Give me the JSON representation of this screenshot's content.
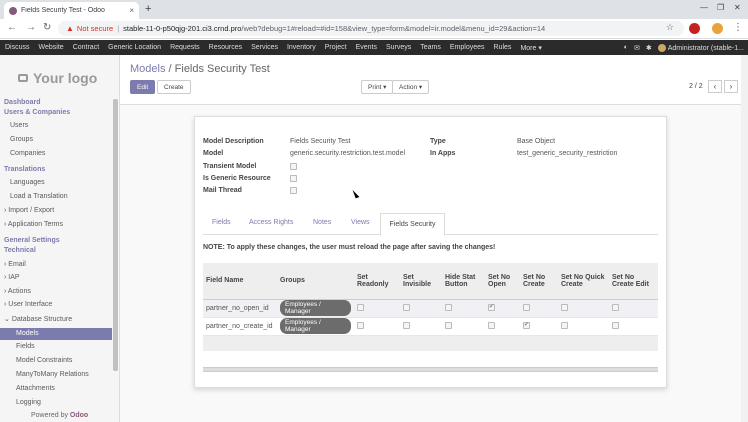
{
  "browser": {
    "tab_title": "Fields Security Test - Odoo",
    "tab_close": "×",
    "new_tab": "+",
    "win_min": "—",
    "win_max": "❐",
    "win_close": "✕",
    "not_secure": "Not secure",
    "url_host": "stable-11-0-p50qjg-201.ci3.crnd.pro",
    "url_path": "/web?debug=1#reload=#id=158&view_type=form&model=ir.model&menu_id=29&action=14"
  },
  "navbar": {
    "menu": [
      "Discuss",
      "Website",
      "Contract",
      "Generic Location",
      "Requests",
      "Resources",
      "Services",
      "Inventory",
      "Project",
      "Events",
      "Surveys",
      "Teams",
      "Employees",
      "Rules",
      "More ▾"
    ],
    "user": "Administrator (stable-1..."
  },
  "sidebar": {
    "logo": "Your logo",
    "dashboard": "Dashboard",
    "users_companies": "Users & Companies",
    "users": "Users",
    "groups": "Groups",
    "companies": "Companies",
    "translations": "Translations",
    "languages": "Languages",
    "load_translation": "Load a Translation",
    "import_export": "Import / Export",
    "application_terms": "Application Terms",
    "general_settings": "General Settings",
    "technical": "Technical",
    "email": "Email",
    "iap": "IAP",
    "actions": "Actions",
    "user_interface": "User Interface",
    "database_structure": "Database Structure",
    "models": "Models",
    "fields": "Fields",
    "model_constraints": "Model Constraints",
    "many2many": "ManyToMany Relations",
    "attachments": "Attachments",
    "logging": "Logging",
    "powered_by": "Powered by",
    "odoo": "Odoo"
  },
  "control": {
    "breadcrumb_parent": "Models",
    "breadcrumb_sep": "/",
    "breadcrumb_current": "Fields Security Test",
    "edit": "Edit",
    "create": "Create",
    "print": "Print ▾",
    "action": "Action ▾",
    "pager": "2 / 2",
    "prev": "‹",
    "next": "›"
  },
  "form": {
    "model_description_label": "Model Description",
    "model_description": "Fields Security Test",
    "model_label": "Model",
    "model": "generic.security.restriction.test.model",
    "transient_label": "Transient Model",
    "generic_resource_label": "Is Generic Resource",
    "mail_thread_label": "Mail Thread",
    "type_label": "Type",
    "type": "Base Object",
    "in_apps_label": "In Apps",
    "in_apps": "test_generic_security_restriction",
    "tabs": [
      "Fields",
      "Access Rights",
      "Notes",
      "Views"
    ],
    "active_tab": "Fields Security",
    "note": "NOTE: To apply these changes, the user must reload the page after saving the changes!"
  },
  "table": {
    "headers": [
      "Field Name",
      "Groups",
      "Set Readonly",
      "Set Invisible",
      "Hide Stat Button",
      "Set No Open",
      "Set No Create",
      "Set No Quick Create",
      "Set No Create Edit"
    ],
    "rows": [
      {
        "field": "partner_no_open_id",
        "group": "Employees / Manager"
      },
      {
        "field": "partner_no_create_id",
        "group": "Employees / Manager"
      }
    ]
  }
}
